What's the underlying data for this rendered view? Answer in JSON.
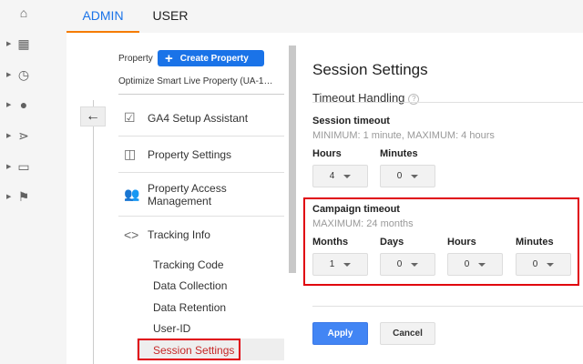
{
  "tabs": [
    {
      "label": "ADMIN",
      "active": true
    },
    {
      "label": "USER",
      "active": false
    }
  ],
  "leftnav": [
    "home-icon",
    "customization-icon",
    "realtime-icon",
    "audience-icon",
    "acquisition-icon",
    "behavior-icon",
    "conversions-icon"
  ],
  "property": {
    "label": "Property",
    "create_label": "Create Property",
    "name": "Optimize Smart Live Property (UA-1…"
  },
  "menu": [
    {
      "label": "GA4 Setup Assistant"
    },
    {
      "label": "Property Settings"
    },
    {
      "label": "Property Access Management"
    },
    {
      "label": "Tracking Info"
    }
  ],
  "submenu": [
    {
      "label": "Tracking Code"
    },
    {
      "label": "Data Collection"
    },
    {
      "label": "Data Retention"
    },
    {
      "label": "User-ID"
    },
    {
      "label": "Session Settings",
      "selected": true
    }
  ],
  "main": {
    "title": "Session Settings",
    "section": "Timeout Handling",
    "help": "?",
    "session": {
      "label": "Session timeout",
      "hint": "MINIMUM: 1 minute, MAXIMUM: 4 hours",
      "hours_label": "Hours",
      "hours": "4",
      "minutes_label": "Minutes",
      "minutes": "0"
    },
    "campaign": {
      "label": "Campaign timeout",
      "hint": "MAXIMUM: 24 months",
      "months_label": "Months",
      "months": "1",
      "days_label": "Days",
      "days": "0",
      "hours_label": "Hours",
      "hours": "0",
      "minutes_label": "Minutes",
      "minutes": "0"
    },
    "apply": "Apply",
    "cancel": "Cancel"
  },
  "colors": {
    "accent": "#1a73e8",
    "highlight": "#e0000d",
    "tab_underline": "#f57c00"
  }
}
